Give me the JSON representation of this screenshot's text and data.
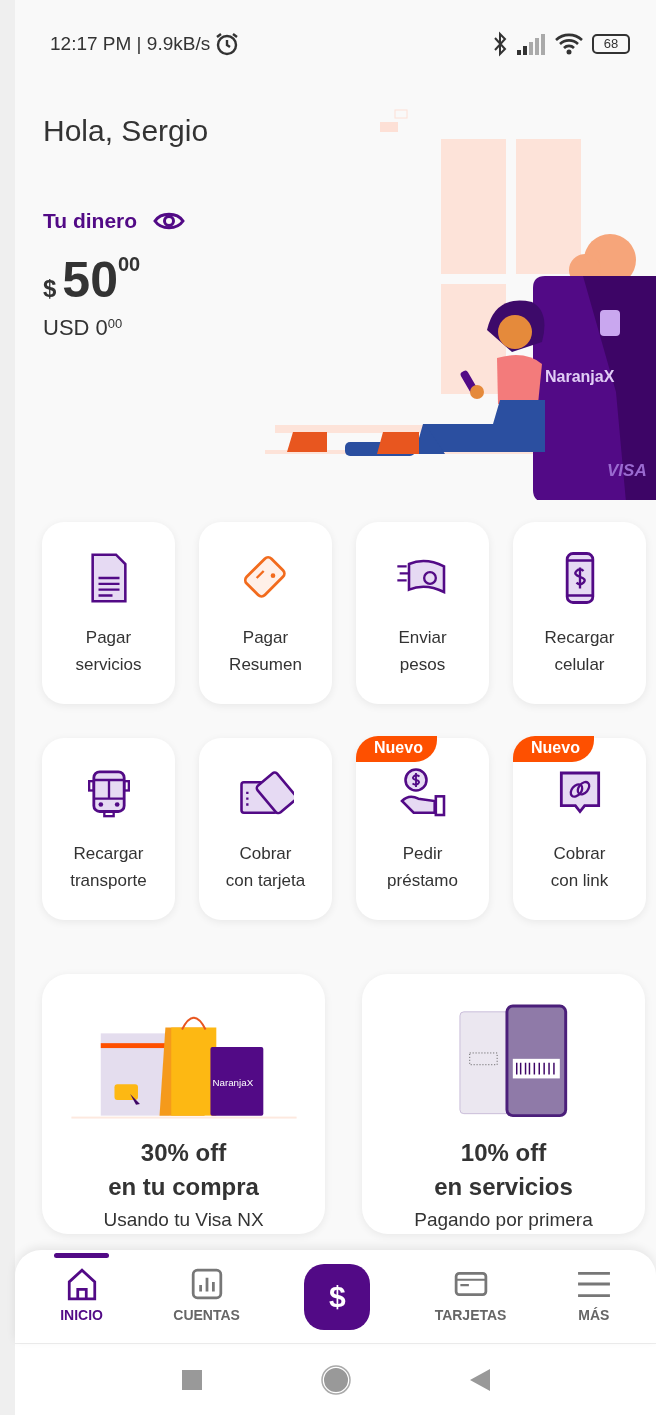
{
  "status_bar": {
    "time": "12:17 PM | 9.9kB/s",
    "battery": "68"
  },
  "greeting": "Hola, Sergio",
  "balance": {
    "label": "Tu dinero",
    "currency": "$",
    "amount": "50$^{00}$",
    "usd": "USD 0$^{00}$"
  },
  "hero": {
    "card_brand": "NaranjaX",
    "card_network": "VISA"
  },
  "shortcuts": [
    {
      "label": "Pagar\nservicios"
    },
    {
      "label": "Pagar\nResumen"
    },
    {
      "label": "Enviar\npesos"
    },
    {
      "label": "Recargar\ncelular"
    },
    {
      "label": "Recargar\ntransporte"
    },
    {
      "label": "Cobrar\ncon tarjeta"
    },
    {
      "label": "Pedir\npréstamo",
      "badge": "Nuevo"
    },
    {
      "label": "Cobrar\ncon link",
      "badge": "Nuevo"
    }
  ],
  "promos": [
    {
      "title": "30% off\nen tu compra",
      "subtitle": "Usando tu Visa NX",
      "card_brand": "NaranjaX"
    },
    {
      "title": "10% off\nen servicios",
      "subtitle": "Pagando por primera"
    }
  ],
  "bottom_nav": [
    {
      "label": "INICIO",
      "selected": true
    },
    {
      "label": "CUENTAS",
      "selected": false
    },
    {
      "kind": "action",
      "label": "$"
    },
    {
      "label": "TARJETAS",
      "selected": false
    },
    {
      "label": "MÁS",
      "selected": false
    }
  ]
}
